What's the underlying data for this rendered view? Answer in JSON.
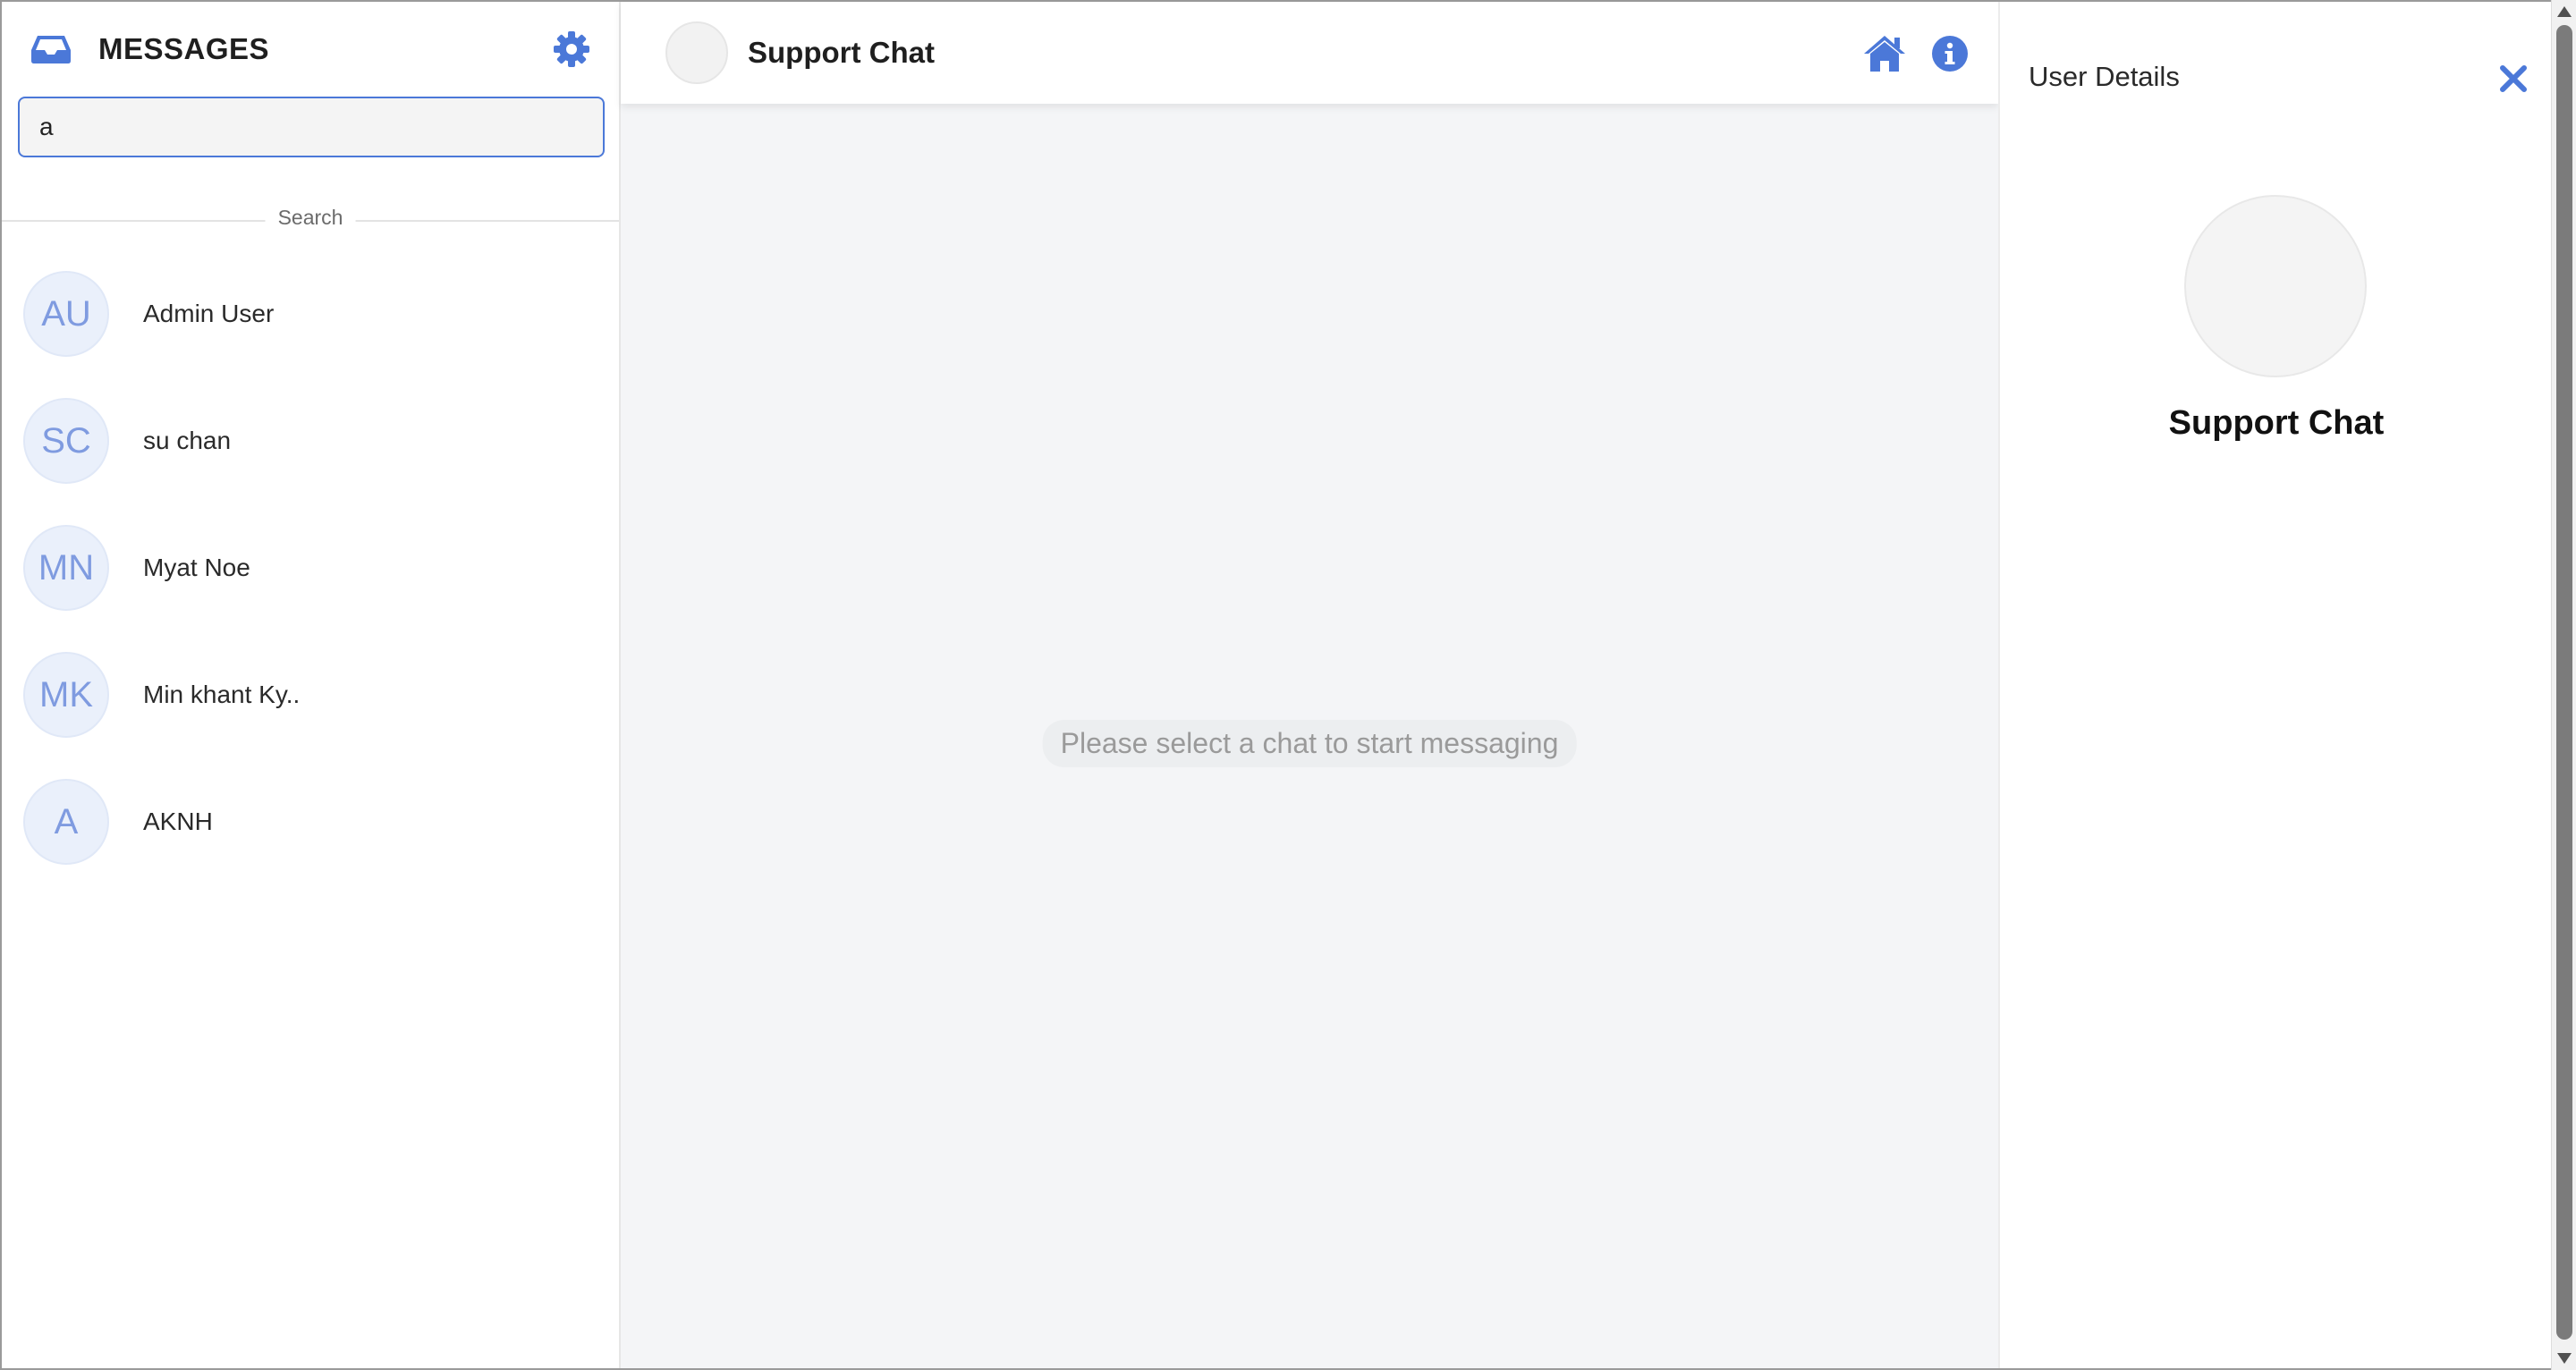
{
  "sidebar": {
    "title": "MESSAGES",
    "search": {
      "value": "a",
      "placeholder": ""
    },
    "section_label": "Search",
    "contacts": [
      {
        "initials": "AU",
        "name": "Admin User"
      },
      {
        "initials": "SC",
        "name": "su chan"
      },
      {
        "initials": "MN",
        "name": "Myat Noe"
      },
      {
        "initials": "MK",
        "name": "Min khant Ky.."
      },
      {
        "initials": "A",
        "name": "AKNH"
      }
    ]
  },
  "chat": {
    "title": "Support Chat",
    "empty_message": "Please select a chat to start messaging"
  },
  "details": {
    "title": "User Details",
    "name": "Support Chat"
  },
  "colors": {
    "accent": "#4b78d8",
    "avatar_bg": "#eaf0fb",
    "avatar_text": "#7f9be0",
    "chat_bg": "#f4f5f7"
  },
  "icons": [
    "inbox-icon",
    "gear-icon",
    "home-icon",
    "info-icon",
    "close-icon"
  ]
}
